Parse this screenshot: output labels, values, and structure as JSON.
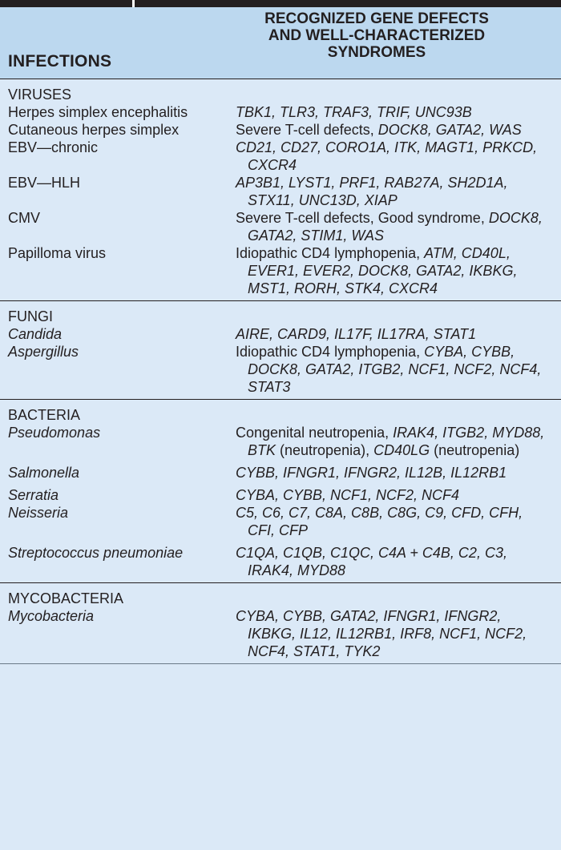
{
  "header": {
    "col1": "INFECTIONS",
    "col2_lines": [
      "RECOGNIZED GENE DEFECTS",
      "AND WELL-CHARACTERIZED",
      "SYNDROMES"
    ]
  },
  "sections": [
    {
      "title": "VIRUSES",
      "rows": [
        {
          "infection": "Herpes simplex encephalitis",
          "defects": "TBK1, TLR3, TRAF3, TRIF, UNC93B"
        },
        {
          "infection": "Cutaneous herpes simplex",
          "defects_prefix": "Severe T-cell defects, ",
          "defects": "DOCK8, GATA2, WAS"
        },
        {
          "infection": "EBV—chronic",
          "defects": "CD21, CD27, CORO1A, ITK, MAGT1, PRKCD, CXCR4"
        },
        {
          "infection": "EBV—HLH",
          "defects": "AP3B1, LYST1, PRF1, RAB27A, SH2D1A, STX11, UNC13D, XIAP"
        },
        {
          "infection": "CMV",
          "defects_prefix": "Severe T-cell defects, Good syndrome, ",
          "defects": "DOCK8, GATA2, STIM1, WAS"
        },
        {
          "infection": "Papilloma virus",
          "defects_prefix": "Idiopathic CD4 lymphopenia, ",
          "defects": "ATM, CD40L, EVER1, EVER2, DOCK8, GATA2, IKBKG, MST1, RORH, STK4, CXCR4"
        }
      ]
    },
    {
      "title": "FUNGI",
      "rows": [
        {
          "infection": "Candida",
          "defects": "AIRE, CARD9, IL17F, IL17RA, STAT1"
        },
        {
          "infection": "Aspergillus",
          "defects_prefix": "Idiopathic CD4 lymphopenia, ",
          "defects": "CYBA, CYBB, DOCK8, GATA2, ITGB2, NCF1, NCF2, NCF4, STAT3"
        }
      ]
    },
    {
      "title": "BACTERIA",
      "rows": [
        {
          "infection": "Pseudomonas",
          "defects_prefix": "Congenital neutropenia, ",
          "defects_a": "IRAK4, ITGB2, MYD88, BTK",
          "defects_b": " (neutropenia), ",
          "defects_c": "CD40LG",
          "defects_d": " (neutropenia)"
        },
        {
          "infection": "Salmonella",
          "defects": "CYBB, IFNGR1, IFNGR2, IL12B, IL12RB1"
        },
        {
          "infection": "Serratia",
          "defects": "CYBA, CYBB, NCF1, NCF2, NCF4"
        },
        {
          "infection": "Neisseria",
          "defects": "C5, C6, C7, C8A, C8B, C8G, C9, CFD, CFH, CFI, CFP"
        },
        {
          "infection": "Streptococcus pneumoniae",
          "defects": "C1QA, C1QB, C1QC, C4A + C4B, C2, C3, IRAK4, MYD88"
        }
      ]
    },
    {
      "title": "MYCOBACTERIA",
      "rows": [
        {
          "infection": "Mycobacteria",
          "defects": "CYBA, CYBB, GATA2, IFNGR1, IFNGR2, IKBKG, IL12, IL12RB1, IRF8, NCF1, NCF2, NCF4, STAT1, TYK2"
        }
      ]
    }
  ]
}
